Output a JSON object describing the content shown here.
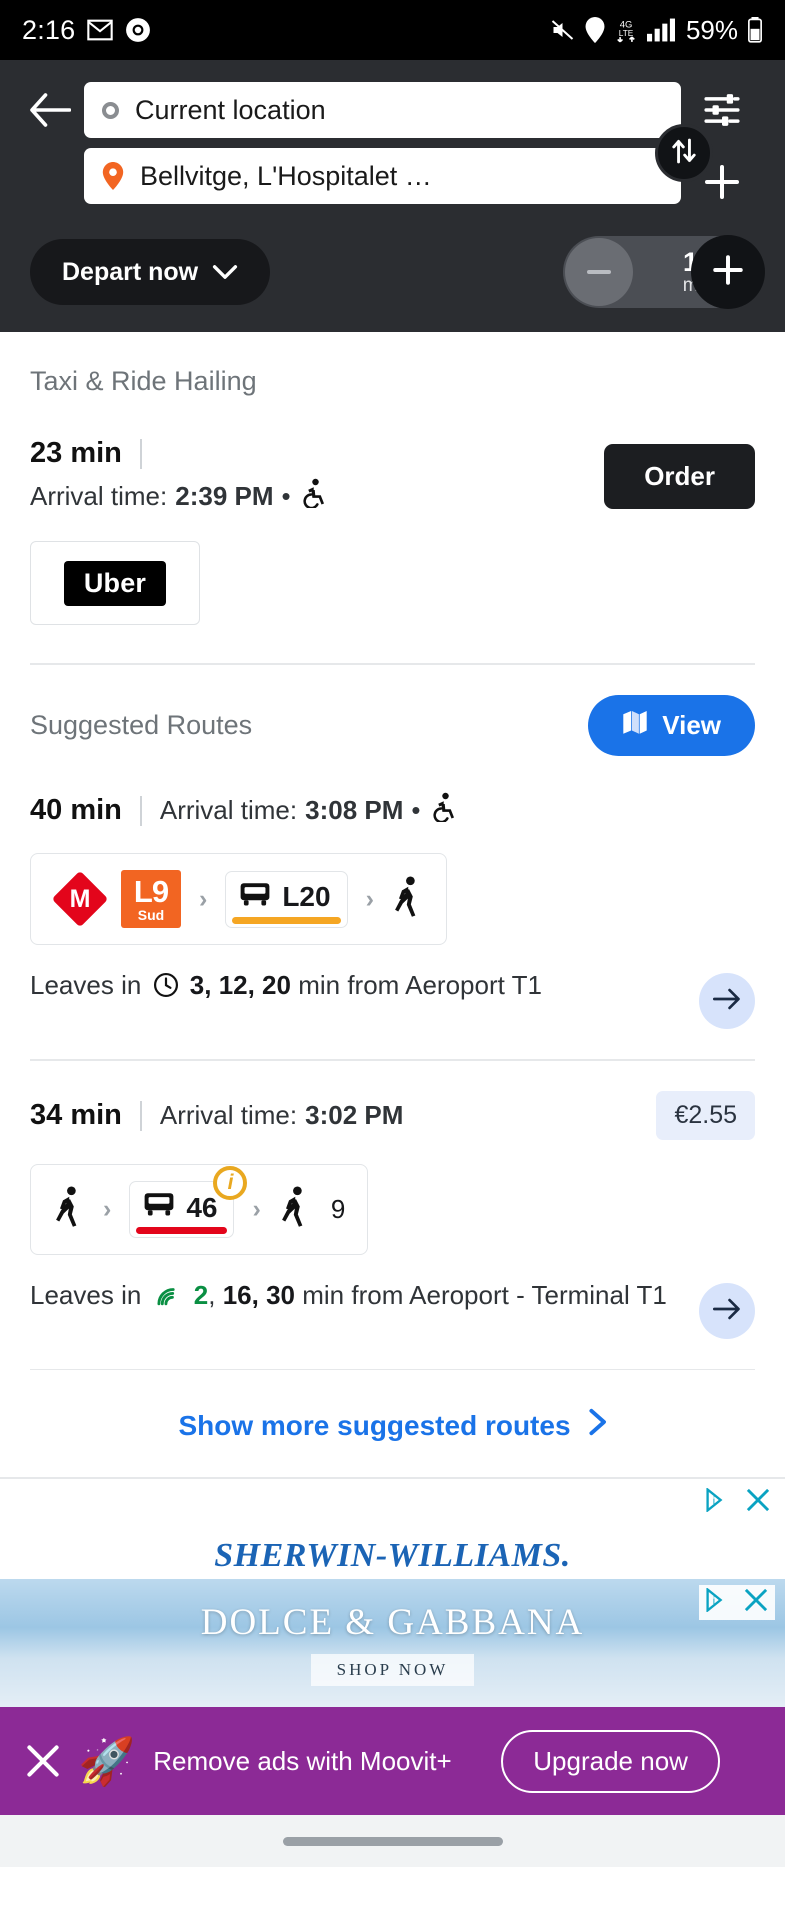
{
  "status_bar": {
    "time": "2:16",
    "left_icons": [
      "gmail-icon",
      "chrome-icon"
    ],
    "right_icons": [
      "mute-icon",
      "location-icon",
      "4g-lte-data-icon",
      "signal-bars-icon",
      "battery-icon"
    ],
    "battery_percent": "59%",
    "network_label": "4G LTE"
  },
  "header": {
    "back_icon": "back-arrow-icon",
    "origin": {
      "value": "Current location",
      "icon": "origin-circle-icon"
    },
    "destination": {
      "value": "Bellvitge, L'Hospitalet …",
      "icon": "destination-pin-icon"
    },
    "swap_icon": "swap-arrows-icon",
    "filter_icon": "filter-settings-icon",
    "add_icon": "plus-icon",
    "depart_label": "Depart now",
    "depart_chevron": "chevron-down-icon",
    "stepper": {
      "minus": "−",
      "value": "15",
      "unit": "min",
      "plus": "+"
    }
  },
  "taxi_section": {
    "title": "Taxi & Ride Hailing",
    "duration": "23 min",
    "arrival_prefix": "Arrival time:",
    "arrival_time": "2:39 PM",
    "separator": "•",
    "accessible_icon": "wheelchair-accessible-icon",
    "order_label": "Order",
    "provider": "Uber"
  },
  "suggested": {
    "title": "Suggested Routes",
    "view_label": "View",
    "view_icon": "map-icon",
    "show_more_label": "Show more suggested routes",
    "show_more_chevron": "chevron-right-icon",
    "routes": [
      {
        "duration": "40 min",
        "arrival_prefix": "Arrival time:",
        "arrival_time": "3:08 PM",
        "separator": "•",
        "accessible_icon": "wheelchair-accessible-icon",
        "price": "",
        "legs": [
          {
            "type": "metro-brand",
            "label": "M",
            "color": "#e3051b"
          },
          {
            "type": "line-badge",
            "label": "L9",
            "sublabel": "Sud",
            "color": "#f26522"
          },
          {
            "type": "chevron",
            "label": "›"
          },
          {
            "type": "bus-line",
            "label": "L20",
            "icon": "bus-icon",
            "color": "#f5a623",
            "info": false
          },
          {
            "type": "chevron",
            "label": "›"
          },
          {
            "type": "walk",
            "icon": "walking-icon",
            "label": ""
          }
        ],
        "leaves_prefix": "Leaves in",
        "leaves_icon": "clock-icon",
        "leaves_live": "",
        "leaves_times": "3, 12, 20",
        "leaves_suffix": "min from Aeroport T1",
        "go_icon": "arrow-right-icon"
      },
      {
        "duration": "34 min",
        "arrival_prefix": "Arrival time:",
        "arrival_time": "3:02 PM",
        "separator": "",
        "accessible_icon": "",
        "price": "€2.55",
        "legs": [
          {
            "type": "walk",
            "icon": "walking-icon",
            "label": ""
          },
          {
            "type": "chevron",
            "label": "›"
          },
          {
            "type": "bus-line",
            "label": "46",
            "icon": "bus-icon",
            "color": "#e3051b",
            "info": true,
            "info_label": "i"
          },
          {
            "type": "chevron",
            "label": "›"
          },
          {
            "type": "walk",
            "icon": "walking-icon",
            "label": "9"
          }
        ],
        "leaves_prefix": "Leaves in",
        "leaves_icon": "live-signal-icon",
        "leaves_live": "2",
        "leaves_times": "16, 30",
        "leaves_suffix": "min from Aeroport - Terminal T1",
        "go_icon": "arrow-right-icon"
      }
    ]
  },
  "ads": {
    "ad1": {
      "brand": "SHERWIN-WILLIAMS.",
      "info_icon": "ad-choices-icon",
      "close_icon": "close-icon"
    },
    "ad2": {
      "brand": "DOLCE & GABBANA",
      "cta": "SHOP NOW",
      "info_icon": "ad-choices-icon",
      "close_icon": "close-icon"
    },
    "moovit": {
      "close_icon": "close-icon",
      "rocket_icon": "rocket-icon",
      "message": "Remove ads with Moovit+",
      "cta": "Upgrade now"
    }
  },
  "colors": {
    "accent_blue": "#1a73e8",
    "metro_red": "#e3051b",
    "line_orange": "#f26522",
    "live_green": "#0a8f43",
    "moovit_purple": "#8c2a96"
  }
}
